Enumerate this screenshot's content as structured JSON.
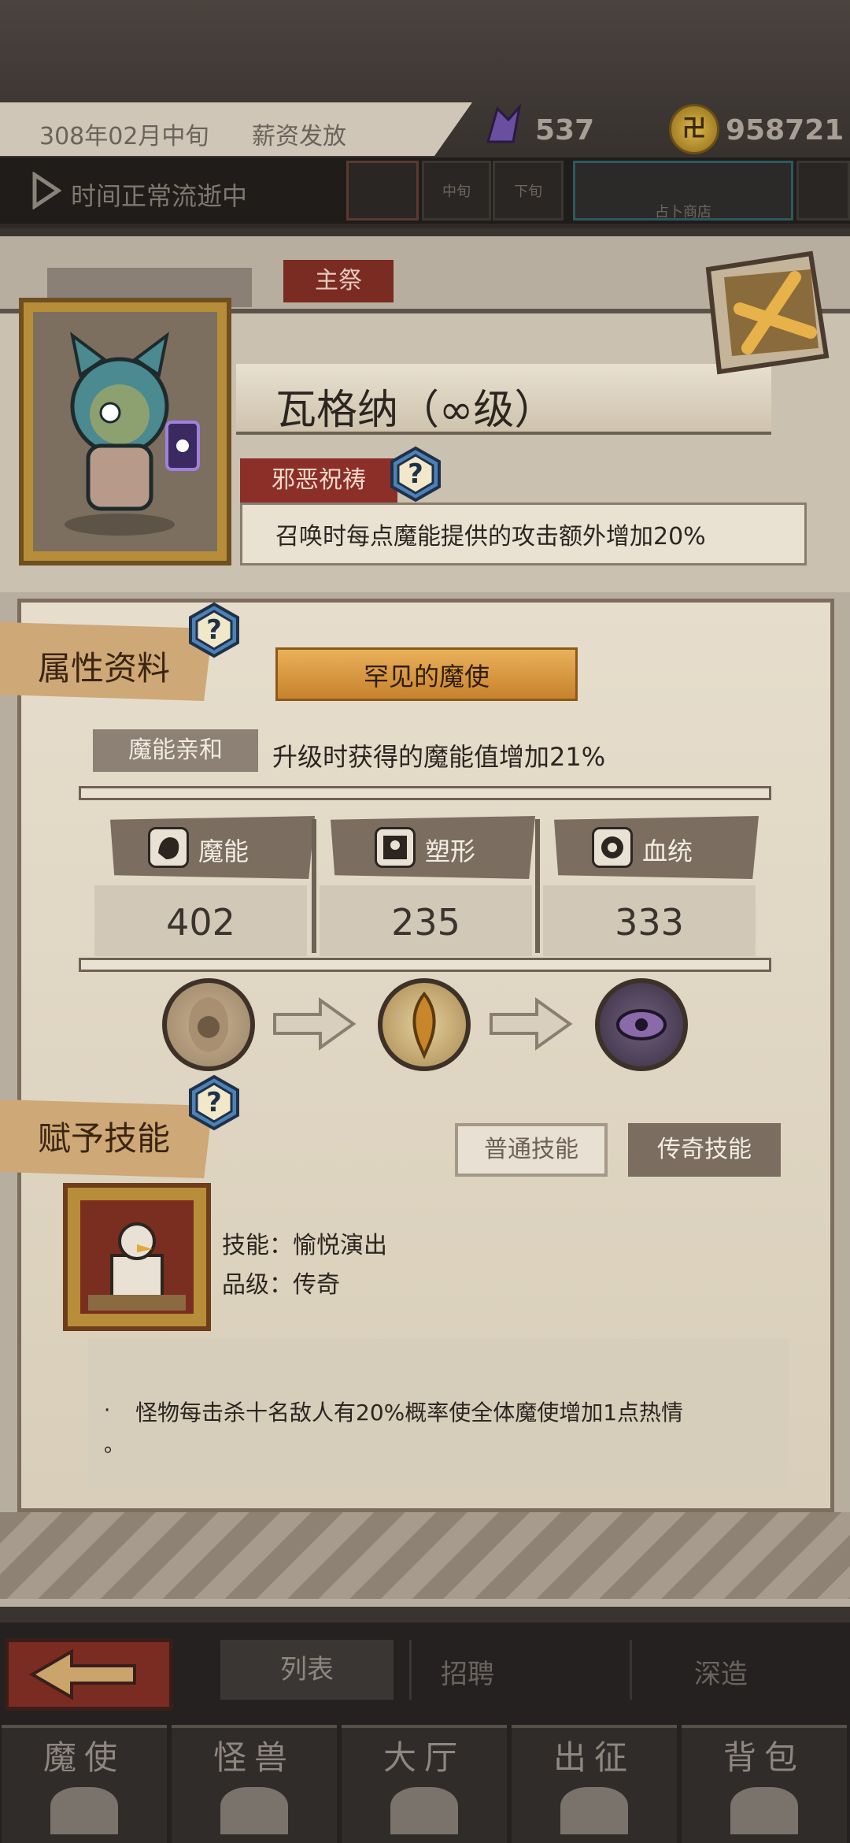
{
  "status": {
    "date": "308年02月中旬",
    "event": "薪资发放",
    "crystal_count": "537",
    "coin_symbol": "卍",
    "coin_count": "958721",
    "time_status": "时间正常流逝中",
    "slots": [
      "",
      "中旬",
      "下旬",
      "占卜商店",
      ""
    ]
  },
  "tabs": {
    "main": "主祭"
  },
  "character": {
    "name": "瓦格纳（∞级）",
    "curse_tag": "邪恶祝祷",
    "curse_desc": "召唤时每点魔能提供的攻击额外增加20%"
  },
  "attributes": {
    "section_label": "属性资料",
    "rarity": "罕见的魔使",
    "affinity_tag": "魔能亲和",
    "affinity_desc": "升级时获得的魔能值增加21%",
    "stats": [
      {
        "name": "魔能",
        "value": "402",
        "icon": "fist-icon"
      },
      {
        "name": "塑形",
        "value": "235",
        "icon": "body-icon"
      },
      {
        "name": "血统",
        "value": "333",
        "icon": "gear-icon"
      }
    ]
  },
  "skills": {
    "section_label": "赋予技能",
    "normal_button": "普通技能",
    "legend_button": "传奇技能",
    "skill_name": "技能：愉悦演出",
    "skill_grade": "品级：传奇",
    "desc_bullet": "·",
    "desc": "怪物每击杀十名敌人有20%概率使全体魔使增加1点热情",
    "desc_end": "。"
  },
  "nav": {
    "list": "列表",
    "recruit": "招聘",
    "forge": "深造",
    "bottom": [
      "魔使",
      "怪兽",
      "大厅",
      "出征",
      "背包"
    ]
  },
  "colors": {
    "accent_red": "#7a2b22",
    "parchment": "#e6ddcc",
    "gold": "#b88d3a"
  }
}
